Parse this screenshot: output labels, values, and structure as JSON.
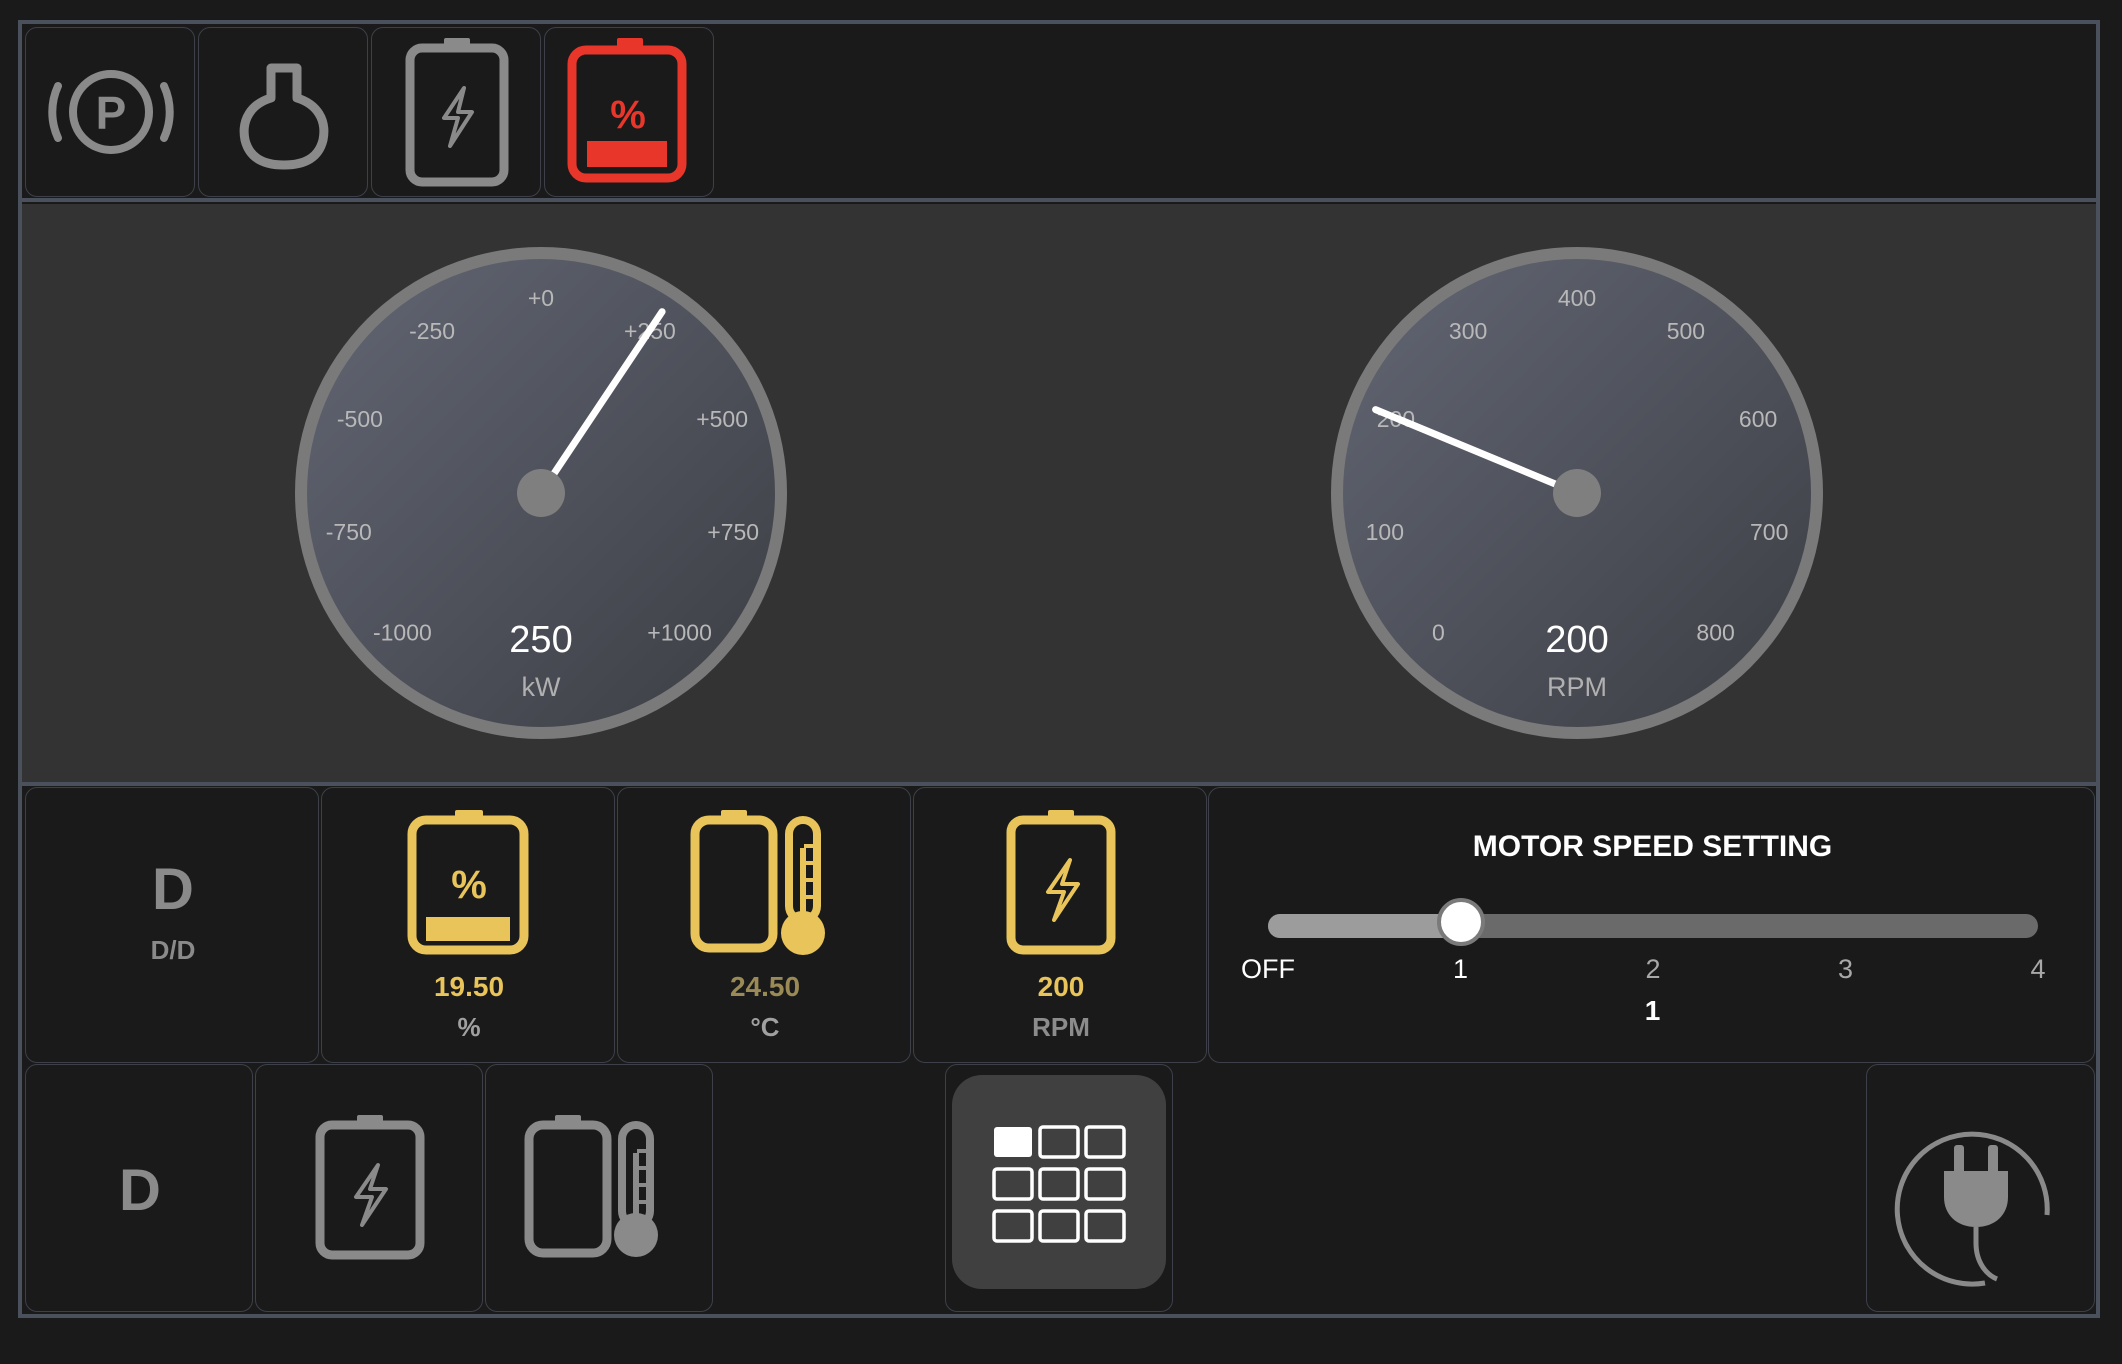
{
  "status_icons": [
    {
      "name": "parking-brake-icon",
      "state": "inactive"
    },
    {
      "name": "engine-bulb-icon",
      "state": "inactive"
    },
    {
      "name": "battery-charge-icon",
      "state": "inactive"
    },
    {
      "name": "battery-percent-icon",
      "state": "alert",
      "symbol": "%"
    }
  ],
  "power_gauge": {
    "ticks": [
      "-1000",
      "-750",
      "-500",
      "-250",
      "+0",
      "+250",
      "+500",
      "+750",
      "+1000"
    ],
    "value": 250,
    "value_text": "250",
    "unit": "kW"
  },
  "rpm_gauge": {
    "ticks": [
      "0",
      "100",
      "200",
      "300",
      "400",
      "500",
      "600",
      "700",
      "800"
    ],
    "value": 200,
    "value_text": "200",
    "unit": "RPM"
  },
  "info_row": {
    "drive_mode": {
      "letter": "D",
      "sub": "D/D"
    },
    "battery_soc": {
      "symbol": "%",
      "value": "19.50",
      "unit": "%"
    },
    "battery_temp": {
      "value": "24.50",
      "unit": "°C"
    },
    "motor_rpm": {
      "value": "200",
      "unit": "RPM"
    }
  },
  "motor_speed": {
    "title": "MOTOR SPEED SETTING",
    "labels": [
      "OFF",
      "1",
      "2",
      "3",
      "4"
    ],
    "selected_index": 1,
    "current": "1"
  },
  "bottom_row": {
    "drive_letter": "D",
    "icons": [
      "battery-charge-icon",
      "battery-temperature-icon",
      "grid-menu-icon",
      "plug-icon"
    ]
  },
  "colors": {
    "background": "#1a1a1a",
    "border": "#4a505c",
    "alert_red": "#e8362a",
    "accent_yellow": "#e8c45a",
    "inactive_grey": "#8a8a8a"
  }
}
